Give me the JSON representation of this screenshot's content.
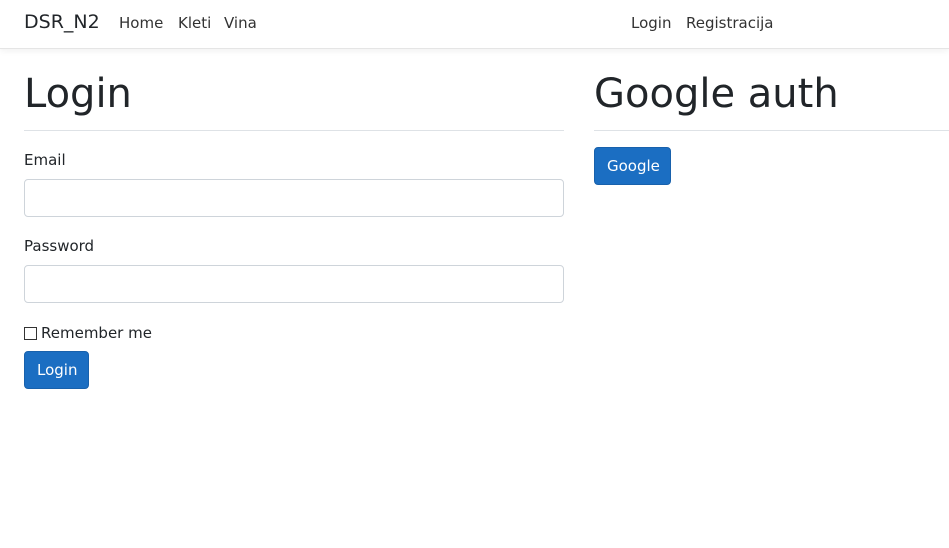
{
  "navbar": {
    "brand": "DSR_N2",
    "left_links": [
      "Home",
      "Kleti",
      "Vina"
    ],
    "right_links": [
      "Login",
      "Registracija"
    ]
  },
  "login_section": {
    "title": "Login",
    "email_label": "Email",
    "email_value": "",
    "password_label": "Password",
    "password_value": "",
    "remember_label": "Remember me",
    "remember_checked": false,
    "submit_label": "Login"
  },
  "google_section": {
    "title": "Google auth",
    "button_label": "Google"
  },
  "colors": {
    "primary_button": "#1b6ec2",
    "primary_button_border": "#1861ac",
    "text": "#212529",
    "divider": "#dee2e6"
  }
}
